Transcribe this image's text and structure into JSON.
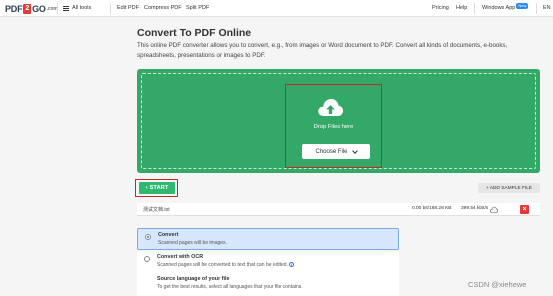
{
  "header": {
    "logo": {
      "left": "PDF",
      "mid": "2",
      "right": "GO",
      "suffix": ".com"
    },
    "all_tools": "All tools",
    "nav_left": [
      "Edit PDF",
      "Compress PDF",
      "Split PDF"
    ],
    "pricing": "Pricing",
    "help": "Help",
    "windows_app": "Windows App",
    "new_badge": "New",
    "lang": "EN"
  },
  "main": {
    "title": "Convert To PDF Online",
    "description": "This online PDF converter allows you to convert, e.g., from images or Word document to PDF. Convert all kinds of documents, e-books, spreadsheets, presentations or images to PDF."
  },
  "dropzone": {
    "drop_text": "Drop Files here",
    "choose_file": "Choose File",
    "icon": "cloud-upload-icon",
    "color": "#34a867"
  },
  "actions": {
    "start": "START",
    "add_sample": "+ ADD SAMPLE FILE"
  },
  "file": {
    "name": "测试文档.txt",
    "size": "0.00 bit/168.28 KB",
    "speed": "399.54 kbit/s"
  },
  "options": {
    "convert_label": "Convert",
    "convert_sub": "Scanned pages will be images.",
    "ocr_label": "Convert with OCR",
    "ocr_sub": "Scanned pages will be converted to text that can be edited.",
    "lang_label": "Source language of your file",
    "lang_sub": "To get the best results, select all languages that your file contains."
  },
  "watermark": "CSDN @xiehewe",
  "colors": {
    "accent_green": "#2eb872",
    "highlight_red": "#c62828",
    "selected_option_bg": "#d6e6fb",
    "delete_red": "#e53935"
  }
}
